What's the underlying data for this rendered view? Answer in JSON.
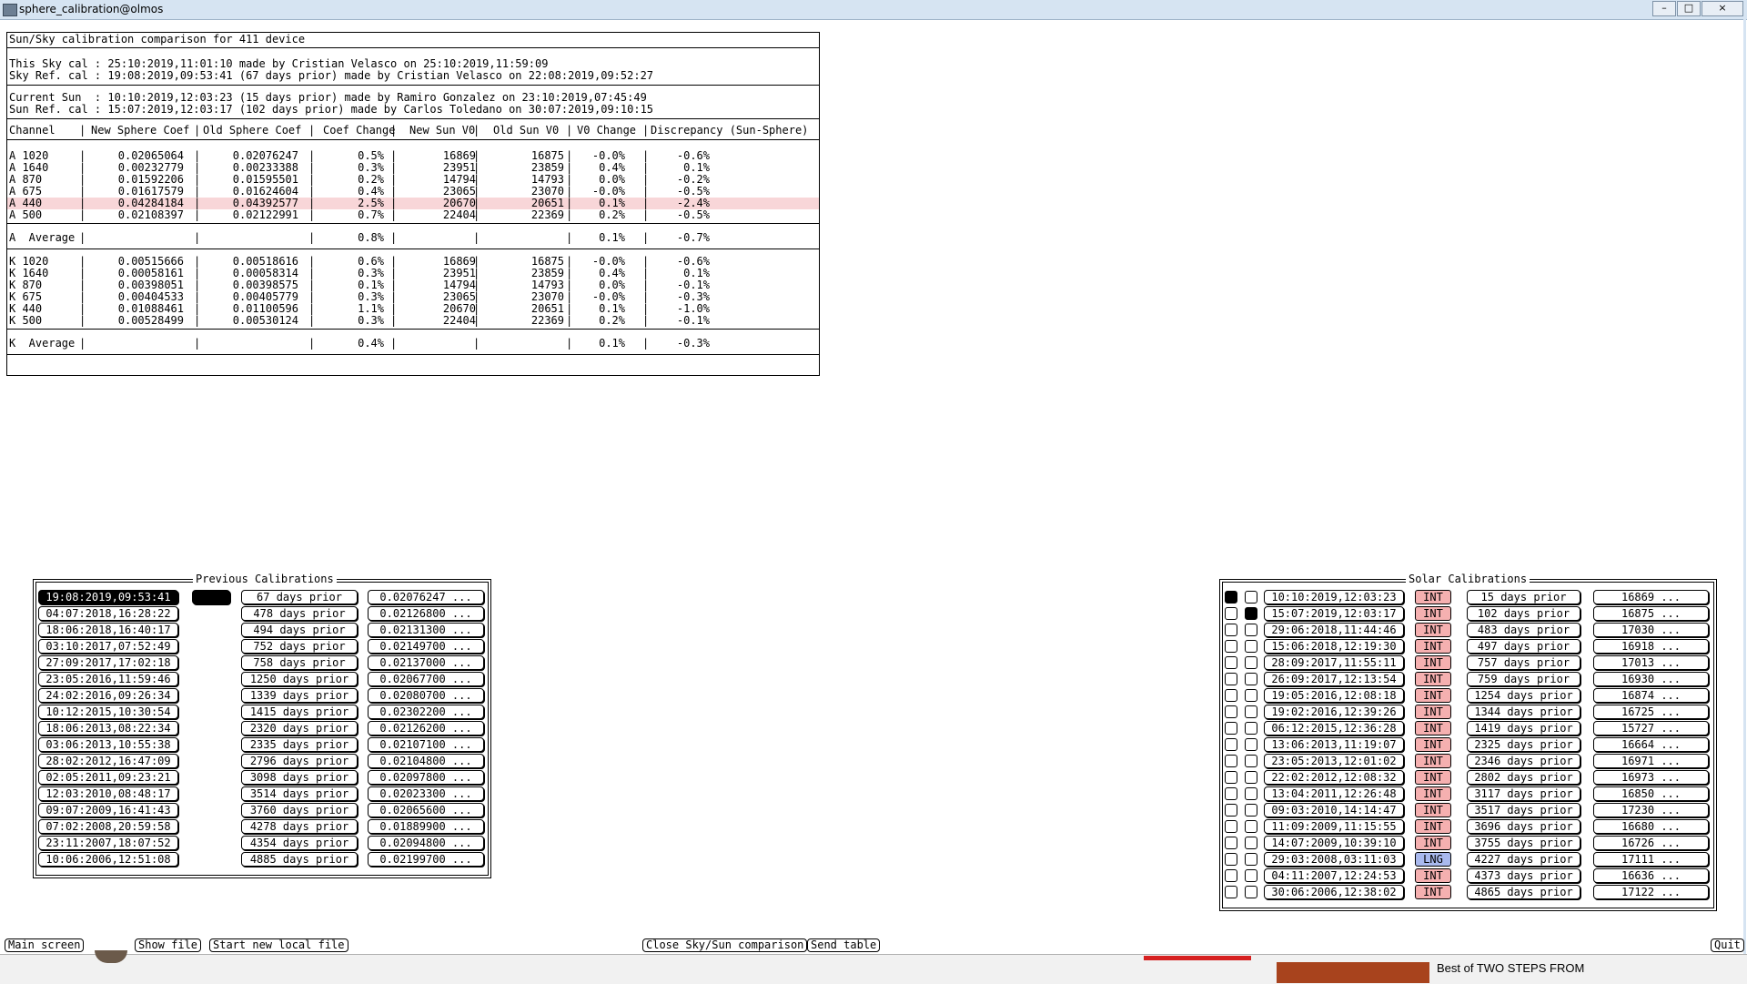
{
  "window": {
    "title": "sphere_calibration@olmos",
    "min": "–",
    "max": "□",
    "close": "×"
  },
  "report": {
    "header": "Sun/Sky calibration comparison for 411 device",
    "sky_lines": [
      "This Sky cal : 25:10:2019,11:01:10 made by Cristian Velasco on 25:10:2019,11:59:09",
      "Sky Ref. cal : 19:08:2019,09:53:41 (67 days prior) made by Cristian Velasco on 22:08:2019,09:52:27"
    ],
    "sun_lines": [
      "Current Sun  : 10:10:2019,12:03:23 (15 days prior) made by Ramiro Gonzalez on 23:10:2019,07:45:49",
      "Sun Ref. cal : 15:07:2019,12:03:17 (102 days prior) made by Carlos Toledano on 30:07:2019,09:10:15"
    ],
    "columns": [
      "Channel",
      "New Sphere Coef",
      "Old Sphere Coef",
      "Coef Change",
      "New Sun V0",
      "Old Sun V0",
      "V0 Change",
      "Discrepancy (Sun-Sphere)"
    ],
    "a_rows": [
      [
        "A 1020",
        "0.02065064",
        "0.02076247",
        "0.5%",
        "16869",
        "16875",
        "-0.0%",
        "-0.6%"
      ],
      [
        "A 1640",
        "0.00232779",
        "0.00233388",
        "0.3%",
        "23951",
        "23859",
        "0.4%",
        "0.1%"
      ],
      [
        "A 870",
        "0.01592206",
        "0.01595501",
        "0.2%",
        "14794",
        "14793",
        "0.0%",
        "-0.2%"
      ],
      [
        "A 675",
        "0.01617579",
        "0.01624604",
        "0.4%",
        "23065",
        "23070",
        "-0.0%",
        "-0.5%"
      ],
      [
        "A 440",
        "0.04284184",
        "0.04392577",
        "2.5%",
        "20670",
        "20651",
        "0.1%",
        "-2.4%"
      ],
      [
        "A 500",
        "0.02108397",
        "0.02122991",
        "0.7%",
        "22404",
        "22369",
        "0.2%",
        "-0.5%"
      ]
    ],
    "a_avg": [
      "A  Average",
      "",
      "",
      "0.8%",
      "",
      "",
      "0.1%",
      "-0.7%"
    ],
    "k_rows": [
      [
        "K 1020",
        "0.00515666",
        "0.00518616",
        "0.6%",
        "16869",
        "16875",
        "-0.0%",
        "-0.6%"
      ],
      [
        "K 1640",
        "0.00058161",
        "0.00058314",
        "0.3%",
        "23951",
        "23859",
        "0.4%",
        "0.1%"
      ],
      [
        "K 870",
        "0.00398051",
        "0.00398575",
        "0.1%",
        "14794",
        "14793",
        "0.0%",
        "-0.1%"
      ],
      [
        "K 675",
        "0.00404533",
        "0.00405779",
        "0.3%",
        "23065",
        "23070",
        "-0.0%",
        "-0.3%"
      ],
      [
        "K 440",
        "0.01088461",
        "0.01100596",
        "1.1%",
        "20670",
        "20651",
        "0.1%",
        "-1.0%"
      ],
      [
        "K 500",
        "0.00528499",
        "0.00530124",
        "0.3%",
        "22404",
        "22369",
        "0.2%",
        "-0.1%"
      ]
    ],
    "k_avg": [
      "K  Average",
      "",
      "",
      "0.4%",
      "",
      "",
      "0.1%",
      "-0.3%"
    ],
    "highlight_color": "#f8d6d8"
  },
  "previous": {
    "title": "Previous Calibrations",
    "rows": [
      {
        "date": "19:08:2019,09:53:41",
        "prior": "67 days prior",
        "coef": "0.02076247 ...",
        "selected": true
      },
      {
        "date": "04:07:2018,16:28:22",
        "prior": "478 days prior",
        "coef": "0.02126800 ..."
      },
      {
        "date": "18:06:2018,16:40:17",
        "prior": "494 days prior",
        "coef": "0.02131300 ..."
      },
      {
        "date": "03:10:2017,07:52:49",
        "prior": "752 days prior",
        "coef": "0.02149700 ..."
      },
      {
        "date": "27:09:2017,17:02:18",
        "prior": "758 days prior",
        "coef": "0.02137000 ..."
      },
      {
        "date": "23:05:2016,11:59:46",
        "prior": "1250 days prior",
        "coef": "0.02067700 ..."
      },
      {
        "date": "24:02:2016,09:26:34",
        "prior": "1339 days prior",
        "coef": "0.02080700 ..."
      },
      {
        "date": "10:12:2015,10:30:54",
        "prior": "1415 days prior",
        "coef": "0.02302200 ..."
      },
      {
        "date": "18:06:2013,08:22:34",
        "prior": "2320 days prior",
        "coef": "0.02126200 ..."
      },
      {
        "date": "03:06:2013,10:55:38",
        "prior": "2335 days prior",
        "coef": "0.02107100 ..."
      },
      {
        "date": "28:02:2012,16:47:09",
        "prior": "2796 days prior",
        "coef": "0.02104800 ..."
      },
      {
        "date": "02:05:2011,09:23:21",
        "prior": "3098 days prior",
        "coef": "0.02097800 ..."
      },
      {
        "date": "12:03:2010,08:48:17",
        "prior": "3514 days prior",
        "coef": "0.02023300 ..."
      },
      {
        "date": "09:07:2009,16:41:43",
        "prior": "3760 days prior",
        "coef": "0.02065600 ..."
      },
      {
        "date": "07:02:2008,20:59:58",
        "prior": "4278 days prior",
        "coef": "0.01889900 ..."
      },
      {
        "date": "23:11:2007,18:07:52",
        "prior": "4354 days prior",
        "coef": "0.02094800 ..."
      },
      {
        "date": "10:06:2006,12:51:08",
        "prior": "4885 days prior",
        "coef": "0.02199700 ..."
      }
    ]
  },
  "solar": {
    "title": "Solar Calibrations",
    "rows": [
      {
        "r1": true,
        "r2": false,
        "date": "10:10:2019,12:03:23",
        "type": "INT",
        "prior": "15 days prior",
        "v0": "16869 ..."
      },
      {
        "r1": false,
        "r2": true,
        "date": "15:07:2019,12:03:17",
        "type": "INT",
        "prior": "102 days prior",
        "v0": "16875 ..."
      },
      {
        "r1": false,
        "r2": false,
        "date": "29:06:2018,11:44:46",
        "type": "INT",
        "prior": "483 days prior",
        "v0": "17030 ..."
      },
      {
        "r1": false,
        "r2": false,
        "date": "15:06:2018,12:19:30",
        "type": "INT",
        "prior": "497 days prior",
        "v0": "16918 ..."
      },
      {
        "r1": false,
        "r2": false,
        "date": "28:09:2017,11:55:11",
        "type": "INT",
        "prior": "757 days prior",
        "v0": "17013 ..."
      },
      {
        "r1": false,
        "r2": false,
        "date": "26:09:2017,12:13:54",
        "type": "INT",
        "prior": "759 days prior",
        "v0": "16930 ..."
      },
      {
        "r1": false,
        "r2": false,
        "date": "19:05:2016,12:08:18",
        "type": "INT",
        "prior": "1254 days prior",
        "v0": "16874 ..."
      },
      {
        "r1": false,
        "r2": false,
        "date": "19:02:2016,12:39:26",
        "type": "INT",
        "prior": "1344 days prior",
        "v0": "16725 ..."
      },
      {
        "r1": false,
        "r2": false,
        "date": "06:12:2015,12:36:28",
        "type": "INT",
        "prior": "1419 days prior",
        "v0": "15727 ..."
      },
      {
        "r1": false,
        "r2": false,
        "date": "13:06:2013,11:19:07",
        "type": "INT",
        "prior": "2325 days prior",
        "v0": "16664 ..."
      },
      {
        "r1": false,
        "r2": false,
        "date": "23:05:2013,12:01:02",
        "type": "INT",
        "prior": "2346 days prior",
        "v0": "16971 ..."
      },
      {
        "r1": false,
        "r2": false,
        "date": "22:02:2012,12:08:32",
        "type": "INT",
        "prior": "2802 days prior",
        "v0": "16973 ..."
      },
      {
        "r1": false,
        "r2": false,
        "date": "13:04:2011,12:26:48",
        "type": "INT",
        "prior": "3117 days prior",
        "v0": "16850 ..."
      },
      {
        "r1": false,
        "r2": false,
        "date": "09:03:2010,14:14:47",
        "type": "INT",
        "prior": "3517 days prior",
        "v0": "17230 ..."
      },
      {
        "r1": false,
        "r2": false,
        "date": "11:09:2009,11:15:55",
        "type": "INT",
        "prior": "3696 days prior",
        "v0": "16680 ..."
      },
      {
        "r1": false,
        "r2": false,
        "date": "14:07:2009,10:39:10",
        "type": "INT",
        "prior": "3755 days prior",
        "v0": "16726 ..."
      },
      {
        "r1": false,
        "r2": false,
        "date": "29:03:2008,03:11:03",
        "type": "LNG",
        "prior": "4227 days prior",
        "v0": "17111 ..."
      },
      {
        "r1": false,
        "r2": false,
        "date": "04:11:2007,12:24:53",
        "type": "INT",
        "prior": "4373 days prior",
        "v0": "16636 ..."
      },
      {
        "r1": false,
        "r2": false,
        "date": "30:06:2006,12:38:02",
        "type": "INT",
        "prior": "4865 days prior",
        "v0": "17122 ..."
      }
    ],
    "int_color": "#f5b0b0",
    "lng_color": "#a9b9ee"
  },
  "buttons": {
    "main_screen": "Main screen",
    "show_file": "Show file",
    "start_new_local_file": "Start new local file",
    "close_comparison": "Close Sky/Sun comparison",
    "send_table": "Send table",
    "quit": "Quit"
  },
  "taskbar": {
    "video_title": "Best of TWO STEPS FROM"
  }
}
